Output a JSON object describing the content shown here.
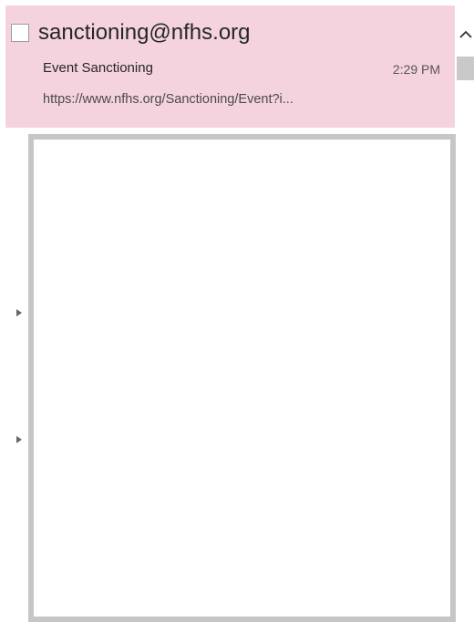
{
  "message": {
    "sender": "sanctioning@nfhs.org",
    "subject": "Event Sanctioning",
    "time": "2:29 PM",
    "preview": "https://www.nfhs.org/Sanctioning/Event?i..."
  },
  "icons": {
    "scroll_up": "chevron-up-icon",
    "expand_arrow": "triangle-right-icon"
  },
  "colors": {
    "selected_item_bg": "#f4d3df",
    "pane_border": "#c6c6c6",
    "scroll_thumb": "#c9c9c9"
  }
}
